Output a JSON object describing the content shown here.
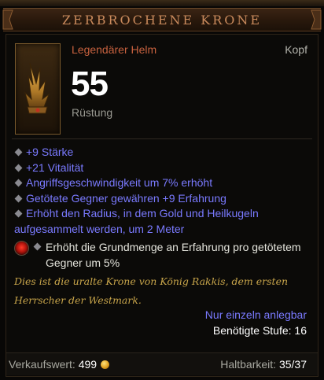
{
  "item": {
    "name": "ZERBROCHENE KRONE",
    "type": "Legendärer Helm",
    "slot": "Kopf",
    "armor_value": "55",
    "armor_label": "Rüstung",
    "icon": "broken-crown-icon"
  },
  "affixes": [
    "+9 Stärke",
    "+21 Vitalität",
    "Angriffsgeschwindigkeit um 7% erhöht",
    "Getötete Gegner gewähren +9 Erfahrung",
    "Erhöht den Radius, in dem Gold und Heilkugeln aufgesammelt werden, um 2 Meter"
  ],
  "legendary_affix": "Erhöht die Grundmenge an Erfahrung pro getötetem Gegner um 5%",
  "flavor_text": "Dies ist die uralte Krone von König Rakkis, dem ersten Herrscher der Westmark.",
  "account_bound": "Nur einzeln anlegbar",
  "required_level": "Benötigte Stufe: 16",
  "sell_value_label": "Verkaufswert:",
  "sell_value": "499",
  "durability_label": "Haltbarkeit:",
  "durability_value": "35/37",
  "colors": {
    "title": "#c98a5c",
    "legendary_type": "#c8623f",
    "magic_affix": "#7a7aff",
    "flavor": "#c7a44a",
    "gold_coin": "#e0a020"
  }
}
